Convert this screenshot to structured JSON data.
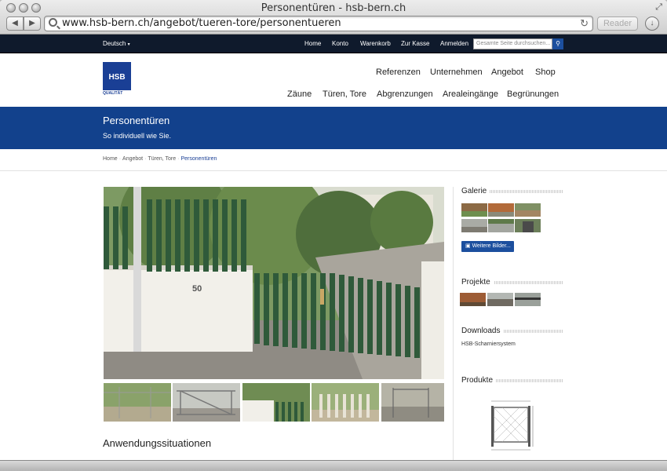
{
  "window": {
    "title": "Personentüren  - hsb-bern.ch"
  },
  "browser": {
    "back_label": "◀",
    "forward_label": "▶",
    "url": "www.hsb-bern.ch/angebot/tueren-tore/personentueren",
    "reader_label": "Reader",
    "reload_icon": "reload-icon",
    "download_icon": "download-icon"
  },
  "topnav": {
    "language": "Deutsch",
    "links": [
      "Home",
      "Konto",
      "Warenkorb",
      "Zur Kasse",
      "Anmelden"
    ],
    "search_placeholder": "Gesamte Seite durchsuchen..."
  },
  "logo": {
    "mark": "HSB",
    "tagline": "QUALITÄT"
  },
  "mainnav": {
    "row1": [
      "Referenzen",
      "Unternehmen",
      "Angebot",
      "Shop"
    ],
    "row2": [
      "Zäune",
      "Türen, Tore",
      "Abgrenzungen",
      "Arealeingänge",
      "Begrünungen"
    ]
  },
  "hero": {
    "title": "Personentüren",
    "tagline": "So individuell wie Sie."
  },
  "breadcrumbs": {
    "items": [
      "Home",
      "Angebot",
      "Türen, Tore"
    ],
    "current": "Personentüren"
  },
  "main": {
    "section_heading": "Anwendungssituationen",
    "house_number": "50"
  },
  "sidebar": {
    "gallery_heading": "Galerie",
    "more_images_label": "Weitere Bilder...",
    "projects_heading": "Projekte",
    "downloads_heading": "Downloads",
    "download_item": "HSB-Scharniersystem",
    "products_heading": "Produkte"
  },
  "colors": {
    "brand_blue": "#12418c",
    "topbar": "#0f1a2c",
    "fence_green": "#2f5a3a"
  }
}
